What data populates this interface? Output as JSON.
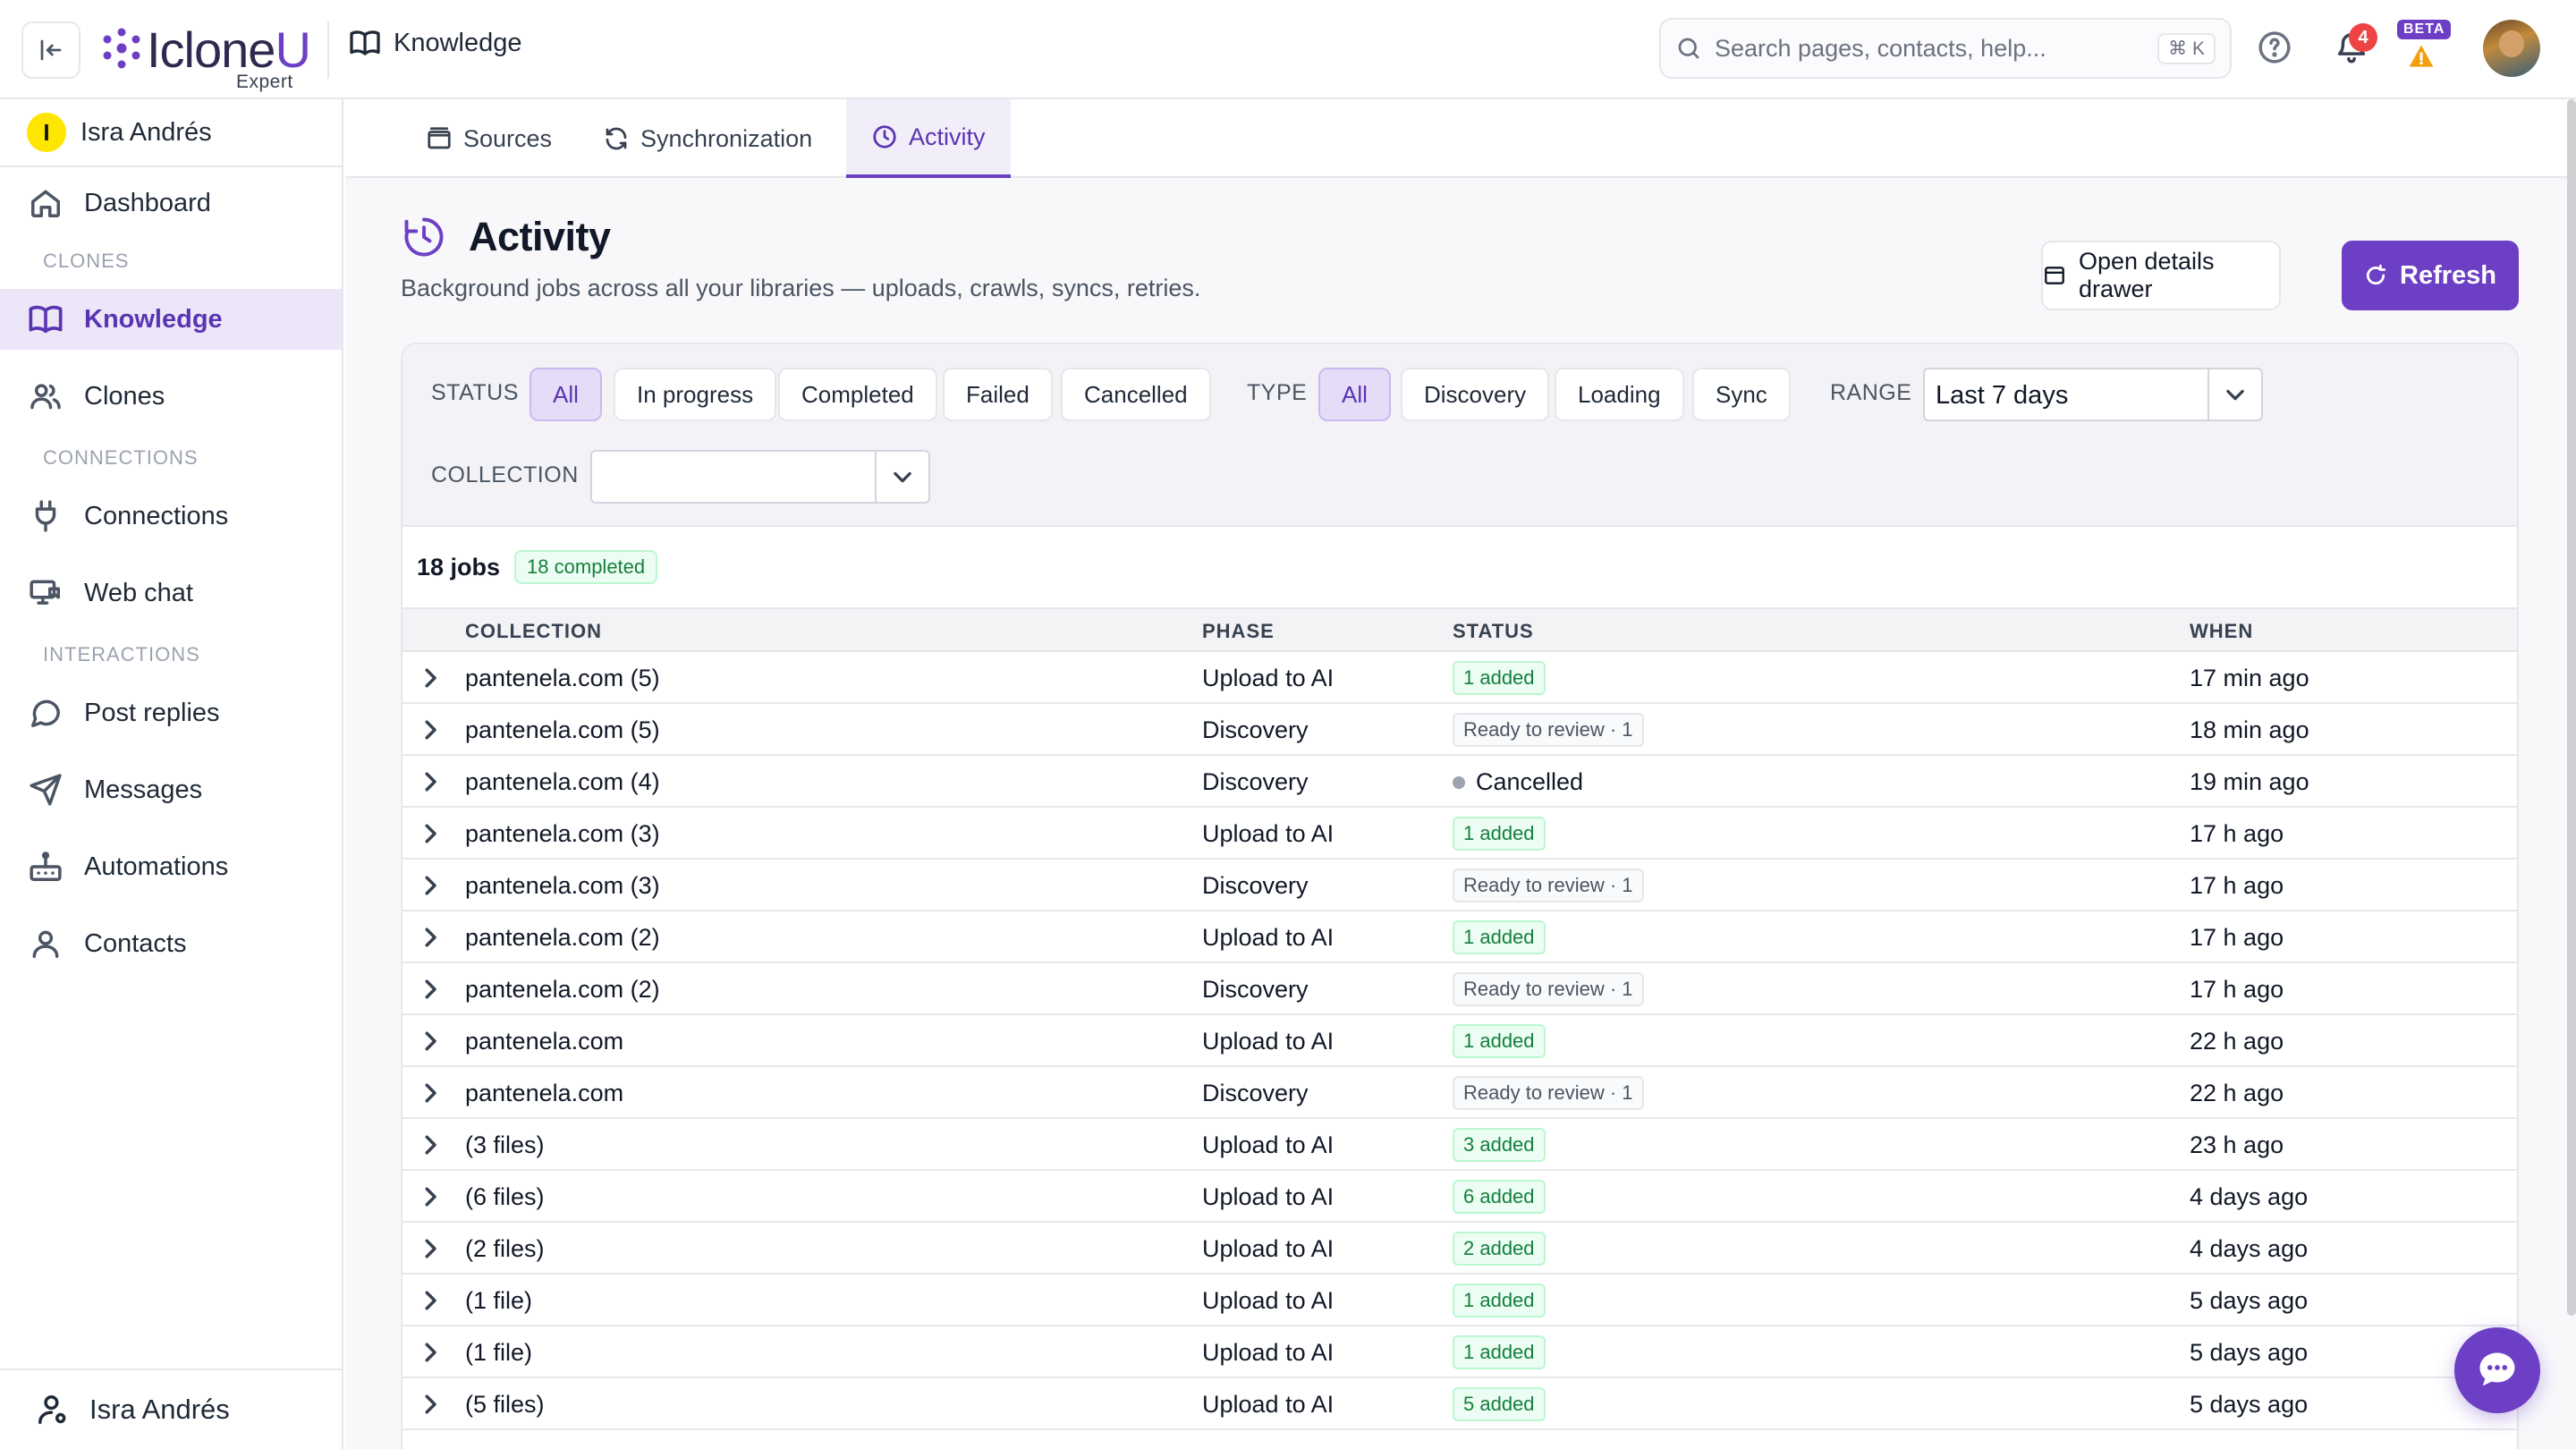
{
  "app": {
    "name": "IcloneU",
    "name_main": "Iclone",
    "name_accent": "U",
    "edition": "Expert",
    "breadcrumb": "Knowledge"
  },
  "search": {
    "placeholder": "Search pages, contacts, help...",
    "shortcut": "⌘ K"
  },
  "notifications": {
    "count": "4"
  },
  "beta_label": "BETA",
  "sidebar": {
    "org": {
      "initial": "I",
      "name": "Isra Andrés"
    },
    "items": [
      {
        "label": "Dashboard",
        "icon": "home-icon"
      },
      {
        "section": "CLONES"
      },
      {
        "label": "Knowledge",
        "icon": "book-icon",
        "active": true
      },
      {
        "label": "Clones",
        "icon": "users-icon"
      },
      {
        "section": "CONNECTIONS"
      },
      {
        "label": "Connections",
        "icon": "plug-icon"
      },
      {
        "label": "Web chat",
        "icon": "monitor-chat-icon"
      },
      {
        "section": "INTERACTIONS"
      },
      {
        "label": "Post replies",
        "icon": "speech-bubble-icon"
      },
      {
        "label": "Messages",
        "icon": "send-icon"
      },
      {
        "label": "Automations",
        "icon": "automation-icon"
      },
      {
        "label": "Contacts",
        "icon": "user-icon"
      }
    ],
    "footer_user": "Isra Andrés"
  },
  "tabs": [
    {
      "label": "Sources",
      "icon": "folder-icon"
    },
    {
      "label": "Synchronization",
      "icon": "sync-icon"
    },
    {
      "label": "Activity",
      "icon": "clock-icon",
      "active": true
    }
  ],
  "page": {
    "title": "Activity",
    "subtitle": "Background jobs across all your libraries — uploads, crawls, syncs, retries.",
    "drawer_button": "Open details drawer",
    "refresh_button": "Refresh"
  },
  "filters": {
    "status_label": "STATUS",
    "status_options": [
      "All",
      "In progress",
      "Completed",
      "Failed",
      "Cancelled"
    ],
    "status_selected": "All",
    "type_label": "TYPE",
    "type_options": [
      "All",
      "Discovery",
      "Loading",
      "Sync"
    ],
    "type_selected": "All",
    "range_label": "RANGE",
    "range_value": "Last 7 days",
    "collection_label": "COLLECTION",
    "collection_value": ""
  },
  "summary": {
    "jobs": "18 jobs",
    "completed": "18 completed"
  },
  "table": {
    "headers": [
      "COLLECTION",
      "PHASE",
      "STATUS",
      "WHEN"
    ],
    "rows": [
      {
        "collection": "pantenela.com (5)",
        "phase": "Upload to AI",
        "status": "1 added",
        "kind": "added",
        "when": "17 min ago"
      },
      {
        "collection": "pantenela.com (5)",
        "phase": "Discovery",
        "status": "Ready to review · 1",
        "kind": "review",
        "when": "18 min ago"
      },
      {
        "collection": "pantenela.com (4)",
        "phase": "Discovery",
        "status": "Cancelled",
        "kind": "cancel",
        "when": "19 min ago"
      },
      {
        "collection": "pantenela.com (3)",
        "phase": "Upload to AI",
        "status": "1 added",
        "kind": "added",
        "when": "17 h ago"
      },
      {
        "collection": "pantenela.com (3)",
        "phase": "Discovery",
        "status": "Ready to review · 1",
        "kind": "review",
        "when": "17 h ago"
      },
      {
        "collection": "pantenela.com (2)",
        "phase": "Upload to AI",
        "status": "1 added",
        "kind": "added",
        "when": "17 h ago"
      },
      {
        "collection": "pantenela.com (2)",
        "phase": "Discovery",
        "status": "Ready to review · 1",
        "kind": "review",
        "when": "17 h ago"
      },
      {
        "collection": "pantenela.com",
        "phase": "Upload to AI",
        "status": "1 added",
        "kind": "added",
        "when": "22 h ago"
      },
      {
        "collection": "pantenela.com",
        "phase": "Discovery",
        "status": "Ready to review · 1",
        "kind": "review",
        "when": "22 h ago"
      },
      {
        "collection": "(3 files)",
        "phase": "Upload to AI",
        "status": "3 added",
        "kind": "added",
        "when": "23 h ago"
      },
      {
        "collection": "(6 files)",
        "phase": "Upload to AI",
        "status": "6 added",
        "kind": "added",
        "when": "4 days ago"
      },
      {
        "collection": "(2 files)",
        "phase": "Upload to AI",
        "status": "2 added",
        "kind": "added",
        "when": "4 days ago"
      },
      {
        "collection": "(1 file)",
        "phase": "Upload to AI",
        "status": "1 added",
        "kind": "added",
        "when": "5 days ago"
      },
      {
        "collection": "(1 file)",
        "phase": "Upload to AI",
        "status": "1 added",
        "kind": "added",
        "when": "5 days ago"
      },
      {
        "collection": "(5 files)",
        "phase": "Upload to AI",
        "status": "5 added",
        "kind": "added",
        "when": "5 days ago"
      }
    ]
  },
  "colors": {
    "accent": "#6d3fc4",
    "accent_soft": "#ece6f8",
    "success": "#15803d",
    "danger": "#ef4444"
  }
}
